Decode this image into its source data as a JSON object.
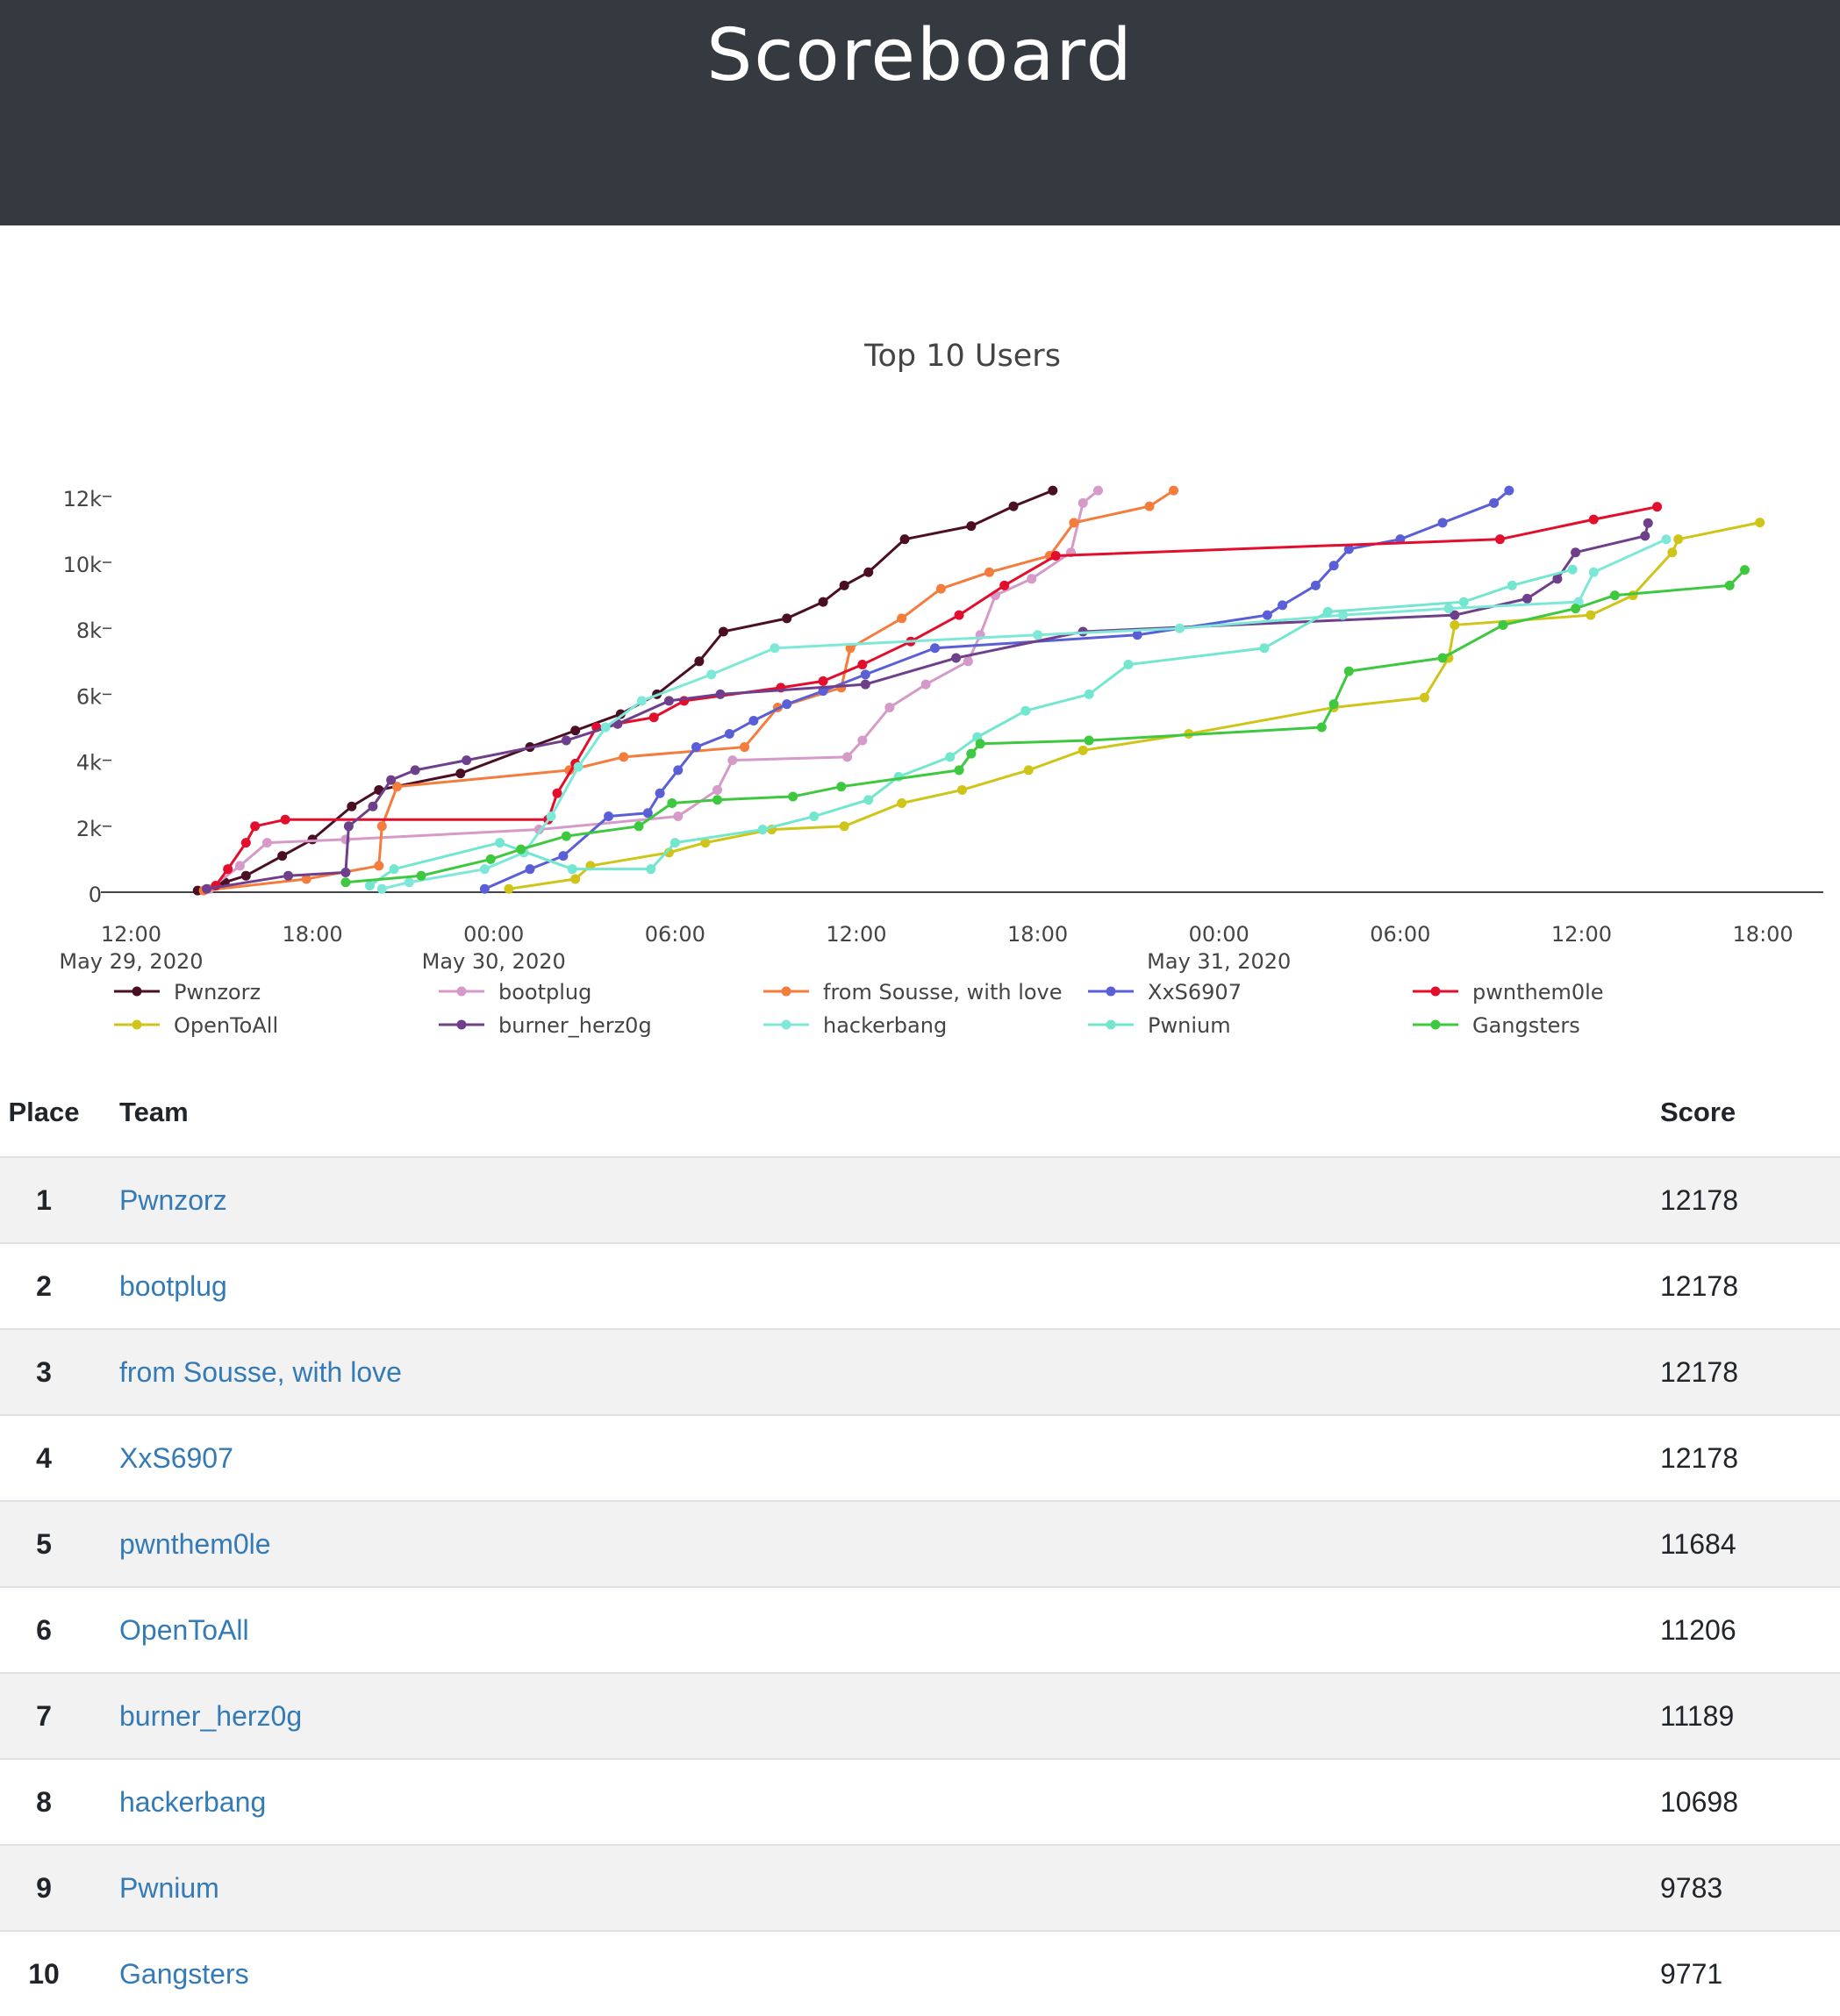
{
  "header": {
    "title": "Scoreboard"
  },
  "colors": {
    "header_bg": "#343a40",
    "link": "#337ab7",
    "series": [
      "#4b0f24",
      "#d59ac8",
      "#f47c3c",
      "#5a5fd8",
      "#e20e2c",
      "#cfc518",
      "#6e3f8a",
      "#7ee8d8",
      "#73e6cf",
      "#3ec83f"
    ]
  },
  "chart_data": {
    "type": "line",
    "title": "Top 10 Users",
    "xlabel": "",
    "ylabel": "",
    "x_range": [
      "2020-05-29 11:00",
      "2020-05-31 20:00"
    ],
    "ylim": [
      0,
      12500
    ],
    "y_ticks": [
      0,
      2000,
      4000,
      6000,
      8000,
      10000,
      12000
    ],
    "y_tick_labels": [
      "0",
      "2k",
      "4k",
      "6k",
      "8k",
      "10k",
      "12k"
    ],
    "x_ticks": [
      {
        "t": "2020-05-29 12:00",
        "label": "12:00",
        "date": "May 29, 2020"
      },
      {
        "t": "2020-05-29 18:00",
        "label": "18:00",
        "date": ""
      },
      {
        "t": "2020-05-30 00:00",
        "label": "00:00",
        "date": "May 30, 2020"
      },
      {
        "t": "2020-05-30 06:00",
        "label": "06:00",
        "date": ""
      },
      {
        "t": "2020-05-30 12:00",
        "label": "12:00",
        "date": ""
      },
      {
        "t": "2020-05-30 18:00",
        "label": "18:00",
        "date": ""
      },
      {
        "t": "2020-05-31 00:00",
        "label": "00:00",
        "date": "May 31, 2020"
      },
      {
        "t": "2020-05-31 06:00",
        "label": "06:00",
        "date": ""
      },
      {
        "t": "2020-05-31 12:00",
        "label": "12:00",
        "date": ""
      },
      {
        "t": "2020-05-31 18:00",
        "label": "18:00",
        "date": ""
      }
    ],
    "grid": false,
    "legend": "bottom",
    "series": [
      {
        "name": "Pwnzorz",
        "color": "#4b0f24",
        "points": [
          [
            "2020-05-29 14:12",
            50
          ],
          [
            "2020-05-29 15:06",
            300
          ],
          [
            "2020-05-29 15:48",
            500
          ],
          [
            "2020-05-29 17:00",
            1100
          ],
          [
            "2020-05-29 18:00",
            1600
          ],
          [
            "2020-05-29 19:18",
            2600
          ],
          [
            "2020-05-29 20:12",
            3100
          ],
          [
            "2020-05-29 22:54",
            3600
          ],
          [
            "2020-05-30 01:12",
            4400
          ],
          [
            "2020-05-30 02:42",
            4900
          ],
          [
            "2020-05-30 04:12",
            5400
          ],
          [
            "2020-05-30 05:24",
            6000
          ],
          [
            "2020-05-30 06:48",
            7000
          ],
          [
            "2020-05-30 07:36",
            7900
          ],
          [
            "2020-05-30 09:42",
            8300
          ],
          [
            "2020-05-30 10:54",
            8800
          ],
          [
            "2020-05-30 11:36",
            9300
          ],
          [
            "2020-05-30 12:24",
            9700
          ],
          [
            "2020-05-30 13:36",
            10700
          ],
          [
            "2020-05-30 15:48",
            11100
          ],
          [
            "2020-05-30 17:12",
            11700
          ],
          [
            "2020-05-30 18:30",
            12178
          ]
        ]
      },
      {
        "name": "bootplug",
        "color": "#d59ac8",
        "points": [
          [
            "2020-05-29 14:36",
            100
          ],
          [
            "2020-05-29 15:36",
            800
          ],
          [
            "2020-05-29 16:30",
            1500
          ],
          [
            "2020-05-29 19:06",
            1600
          ],
          [
            "2020-05-30 01:30",
            1900
          ],
          [
            "2020-05-30 06:06",
            2300
          ],
          [
            "2020-05-30 07:24",
            3100
          ],
          [
            "2020-05-30 07:54",
            4000
          ],
          [
            "2020-05-30 11:42",
            4100
          ],
          [
            "2020-05-30 12:12",
            4600
          ],
          [
            "2020-05-30 13:06",
            5600
          ],
          [
            "2020-05-30 14:18",
            6300
          ],
          [
            "2020-05-30 15:42",
            7000
          ],
          [
            "2020-05-30 16:06",
            7800
          ],
          [
            "2020-05-30 16:36",
            9000
          ],
          [
            "2020-05-30 17:48",
            9500
          ],
          [
            "2020-05-30 19:06",
            10300
          ],
          [
            "2020-05-30 19:30",
            11800
          ],
          [
            "2020-05-30 20:00",
            12178
          ]
        ]
      },
      {
        "name": "from Sousse, with love",
        "color": "#f47c3c",
        "points": [
          [
            "2020-05-29 14:24",
            50
          ],
          [
            "2020-05-29 17:48",
            400
          ],
          [
            "2020-05-29 20:12",
            800
          ],
          [
            "2020-05-29 20:18",
            2000
          ],
          [
            "2020-05-29 20:48",
            3200
          ],
          [
            "2020-05-30 02:30",
            3700
          ],
          [
            "2020-05-30 04:18",
            4100
          ],
          [
            "2020-05-30 08:18",
            4400
          ],
          [
            "2020-05-30 09:24",
            5600
          ],
          [
            "2020-05-30 11:30",
            6200
          ],
          [
            "2020-05-30 11:48",
            7400
          ],
          [
            "2020-05-30 13:30",
            8300
          ],
          [
            "2020-05-30 14:48",
            9200
          ],
          [
            "2020-05-30 16:24",
            9700
          ],
          [
            "2020-05-30 18:24",
            10200
          ],
          [
            "2020-05-30 19:12",
            11200
          ],
          [
            "2020-05-30 21:42",
            11700
          ],
          [
            "2020-05-30 22:30",
            12178
          ]
        ]
      },
      {
        "name": "XxS6907",
        "color": "#5a5fd8",
        "points": [
          [
            "2020-05-29 23:42",
            100
          ],
          [
            "2020-05-30 01:12",
            700
          ],
          [
            "2020-05-30 02:18",
            1100
          ],
          [
            "2020-05-30 03:48",
            2300
          ],
          [
            "2020-05-30 05:06",
            2400
          ],
          [
            "2020-05-30 05:30",
            3000
          ],
          [
            "2020-05-30 06:06",
            3700
          ],
          [
            "2020-05-30 06:42",
            4400
          ],
          [
            "2020-05-30 07:48",
            4800
          ],
          [
            "2020-05-30 08:36",
            5200
          ],
          [
            "2020-05-30 09:42",
            5700
          ],
          [
            "2020-05-30 10:54",
            6100
          ],
          [
            "2020-05-30 12:18",
            6600
          ],
          [
            "2020-05-30 14:36",
            7400
          ],
          [
            "2020-05-30 21:18",
            7800
          ],
          [
            "2020-05-31 01:36",
            8400
          ],
          [
            "2020-05-31 02:06",
            8700
          ],
          [
            "2020-05-31 03:12",
            9300
          ],
          [
            "2020-05-31 03:48",
            9900
          ],
          [
            "2020-05-31 04:18",
            10400
          ],
          [
            "2020-05-31 06:00",
            10700
          ],
          [
            "2020-05-31 07:24",
            11200
          ],
          [
            "2020-05-31 09:06",
            11800
          ],
          [
            "2020-05-31 09:36",
            12178
          ]
        ]
      },
      {
        "name": "pwnthem0le",
        "color": "#e20e2c",
        "points": [
          [
            "2020-05-29 14:48",
            200
          ],
          [
            "2020-05-29 15:12",
            700
          ],
          [
            "2020-05-29 15:48",
            1500
          ],
          [
            "2020-05-29 16:06",
            2000
          ],
          [
            "2020-05-29 17:06",
            2200
          ],
          [
            "2020-05-30 01:48",
            2200
          ],
          [
            "2020-05-30 02:06",
            3000
          ],
          [
            "2020-05-30 02:42",
            3900
          ],
          [
            "2020-05-30 03:24",
            5000
          ],
          [
            "2020-05-30 05:18",
            5300
          ],
          [
            "2020-05-30 06:18",
            5800
          ],
          [
            "2020-05-30 09:30",
            6200
          ],
          [
            "2020-05-30 10:54",
            6400
          ],
          [
            "2020-05-30 12:12",
            6900
          ],
          [
            "2020-05-30 13:48",
            7600
          ],
          [
            "2020-05-30 15:24",
            8400
          ],
          [
            "2020-05-30 16:54",
            9300
          ],
          [
            "2020-05-30 18:36",
            10200
          ],
          [
            "2020-05-31 09:18",
            10700
          ],
          [
            "2020-05-31 12:24",
            11300
          ],
          [
            "2020-05-31 14:30",
            11684
          ]
        ]
      },
      {
        "name": "OpenToAll",
        "color": "#cfc518",
        "points": [
          [
            "2020-05-30 00:30",
            100
          ],
          [
            "2020-05-30 02:42",
            400
          ],
          [
            "2020-05-30 03:12",
            800
          ],
          [
            "2020-05-30 05:48",
            1200
          ],
          [
            "2020-05-30 07:00",
            1500
          ],
          [
            "2020-05-30 09:12",
            1900
          ],
          [
            "2020-05-30 11:36",
            2000
          ],
          [
            "2020-05-30 13:30",
            2700
          ],
          [
            "2020-05-30 15:30",
            3100
          ],
          [
            "2020-05-30 17:42",
            3700
          ],
          [
            "2020-05-30 19:30",
            4300
          ],
          [
            "2020-05-30 23:00",
            4800
          ],
          [
            "2020-05-31 03:48",
            5600
          ],
          [
            "2020-05-31 06:48",
            5900
          ],
          [
            "2020-05-31 07:36",
            7100
          ],
          [
            "2020-05-31 07:48",
            8100
          ],
          [
            "2020-05-31 12:18",
            8400
          ],
          [
            "2020-05-31 13:42",
            9000
          ],
          [
            "2020-05-31 15:00",
            10300
          ],
          [
            "2020-05-31 15:12",
            10700
          ],
          [
            "2020-05-31 17:54",
            11206
          ]
        ]
      },
      {
        "name": "burner_herz0g",
        "color": "#6e3f8a",
        "points": [
          [
            "2020-05-29 14:30",
            100
          ],
          [
            "2020-05-29 17:12",
            500
          ],
          [
            "2020-05-29 19:06",
            600
          ],
          [
            "2020-05-29 19:12",
            2000
          ],
          [
            "2020-05-29 20:00",
            2600
          ],
          [
            "2020-05-29 20:36",
            3400
          ],
          [
            "2020-05-29 21:24",
            3700
          ],
          [
            "2020-05-29 23:06",
            4000
          ],
          [
            "2020-05-30 02:24",
            4600
          ],
          [
            "2020-05-30 04:06",
            5100
          ],
          [
            "2020-05-30 05:48",
            5800
          ],
          [
            "2020-05-30 07:30",
            6000
          ],
          [
            "2020-05-30 12:18",
            6300
          ],
          [
            "2020-05-30 15:18",
            7100
          ],
          [
            "2020-05-30 19:30",
            7900
          ],
          [
            "2020-05-31 07:48",
            8400
          ],
          [
            "2020-05-31 10:12",
            8900
          ],
          [
            "2020-05-31 11:12",
            9500
          ],
          [
            "2020-05-31 11:48",
            10300
          ],
          [
            "2020-05-31 14:06",
            10800
          ],
          [
            "2020-05-31 14:12",
            11189
          ]
        ]
      },
      {
        "name": "hackerbang",
        "color": "#7ee8d8",
        "points": [
          [
            "2020-05-29 20:18",
            100
          ],
          [
            "2020-05-29 21:12",
            300
          ],
          [
            "2020-05-29 23:42",
            700
          ],
          [
            "2020-05-30 01:00",
            1200
          ],
          [
            "2020-05-30 01:54",
            2300
          ],
          [
            "2020-05-30 02:48",
            3800
          ],
          [
            "2020-05-30 03:42",
            5000
          ],
          [
            "2020-05-30 04:54",
            5800
          ],
          [
            "2020-05-30 07:12",
            6600
          ],
          [
            "2020-05-30 09:18",
            7400
          ],
          [
            "2020-05-30 18:00",
            7800
          ],
          [
            "2020-05-30 22:42",
            8000
          ],
          [
            "2020-05-31 04:06",
            8400
          ],
          [
            "2020-05-31 07:36",
            8600
          ],
          [
            "2020-05-31 11:54",
            8800
          ],
          [
            "2020-05-31 12:24",
            9700
          ],
          [
            "2020-05-31 14:48",
            10698
          ]
        ]
      },
      {
        "name": "Pwnium",
        "color": "#73e6cf",
        "points": [
          [
            "2020-05-29 19:54",
            200
          ],
          [
            "2020-05-29 20:42",
            700
          ],
          [
            "2020-05-30 00:12",
            1500
          ],
          [
            "2020-05-30 02:36",
            700
          ],
          [
            "2020-05-30 05:12",
            700
          ],
          [
            "2020-05-30 06:00",
            1500
          ],
          [
            "2020-05-30 08:54",
            1900
          ],
          [
            "2020-05-30 10:36",
            2300
          ],
          [
            "2020-05-30 12:24",
            2800
          ],
          [
            "2020-05-30 13:24",
            3500
          ],
          [
            "2020-05-30 15:06",
            4100
          ],
          [
            "2020-05-30 16:00",
            4700
          ],
          [
            "2020-05-30 17:36",
            5500
          ],
          [
            "2020-05-30 19:42",
            6000
          ],
          [
            "2020-05-30 21:00",
            6900
          ],
          [
            "2020-05-31 01:30",
            7400
          ],
          [
            "2020-05-31 03:36",
            8500
          ],
          [
            "2020-05-31 08:06",
            8800
          ],
          [
            "2020-05-31 09:42",
            9300
          ],
          [
            "2020-05-31 11:42",
            9783
          ]
        ]
      },
      {
        "name": "Gangsters",
        "color": "#3ec83f",
        "points": [
          [
            "2020-05-29 19:06",
            300
          ],
          [
            "2020-05-29 21:36",
            500
          ],
          [
            "2020-05-29 23:54",
            1000
          ],
          [
            "2020-05-30 00:54",
            1300
          ],
          [
            "2020-05-30 02:24",
            1700
          ],
          [
            "2020-05-30 04:48",
            2000
          ],
          [
            "2020-05-30 05:54",
            2700
          ],
          [
            "2020-05-30 07:24",
            2800
          ],
          [
            "2020-05-30 09:54",
            2900
          ],
          [
            "2020-05-30 11:30",
            3200
          ],
          [
            "2020-05-30 15:24",
            3700
          ],
          [
            "2020-05-30 15:48",
            4200
          ],
          [
            "2020-05-30 16:06",
            4500
          ],
          [
            "2020-05-30 19:42",
            4600
          ],
          [
            "2020-05-31 03:24",
            5000
          ],
          [
            "2020-05-31 03:48",
            5700
          ],
          [
            "2020-05-31 04:18",
            6700
          ],
          [
            "2020-05-31 07:24",
            7100
          ],
          [
            "2020-05-31 09:24",
            8100
          ],
          [
            "2020-05-31 11:48",
            8600
          ],
          [
            "2020-05-31 13:06",
            9000
          ],
          [
            "2020-05-31 16:54",
            9300
          ],
          [
            "2020-05-31 17:24",
            9771
          ]
        ]
      }
    ]
  },
  "table": {
    "headers": {
      "place": "Place",
      "team": "Team",
      "score": "Score"
    },
    "rows": [
      {
        "place": "1",
        "team": "Pwnzorz",
        "score": "12178"
      },
      {
        "place": "2",
        "team": "bootplug",
        "score": "12178"
      },
      {
        "place": "3",
        "team": "from Sousse, with love",
        "score": "12178"
      },
      {
        "place": "4",
        "team": "XxS6907",
        "score": "12178"
      },
      {
        "place": "5",
        "team": "pwnthem0le",
        "score": "11684"
      },
      {
        "place": "6",
        "team": "OpenToAll",
        "score": "11206"
      },
      {
        "place": "7",
        "team": "burner_herz0g",
        "score": "11189"
      },
      {
        "place": "8",
        "team": "hackerbang",
        "score": "10698"
      },
      {
        "place": "9",
        "team": "Pwnium",
        "score": "9783"
      },
      {
        "place": "10",
        "team": "Gangsters",
        "score": "9771"
      }
    ]
  }
}
